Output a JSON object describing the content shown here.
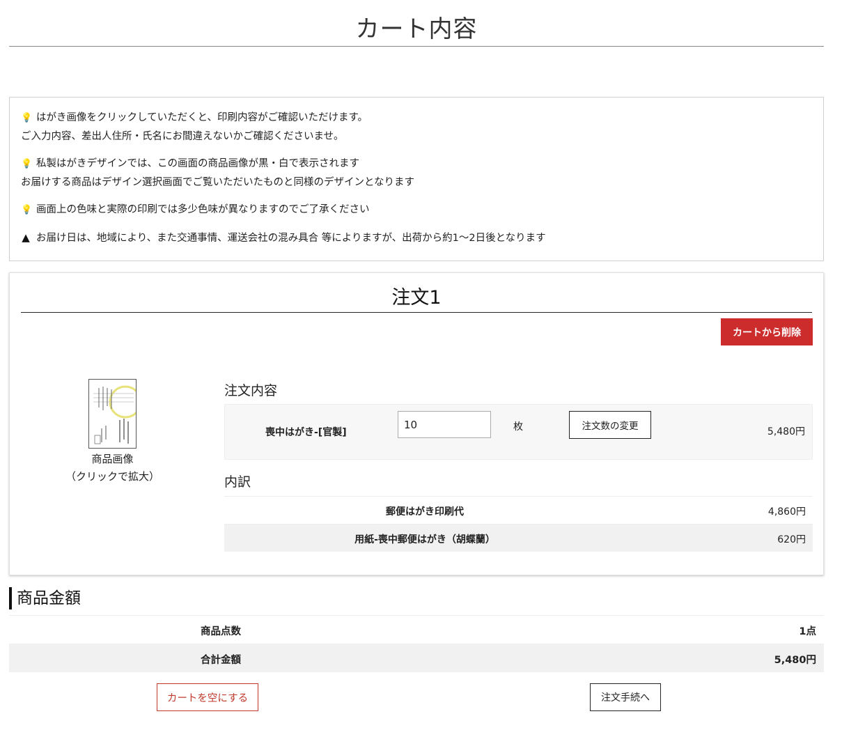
{
  "page": {
    "title": "カート内容"
  },
  "notices": [
    {
      "icon": "lightbulb-icon",
      "lines": [
        "はがき画像をクリックしていただくと、印刷内容がご確認いただけます。",
        "ご入力内容、差出人住所・氏名にお間違えないかご確認くださいませ。"
      ]
    },
    {
      "icon": "lightbulb-icon",
      "lines": [
        "私製はがきデザインでは、この画面の商品画像が黒・白で表示されます",
        "お届けする商品はデザイン選択画面でご覧いただいたものと同様のデザインとなります"
      ]
    },
    {
      "icon": "lightbulb-icon",
      "lines": [
        "画面上の色味と実際の印刷では多少色味が異なりますのでご了承ください"
      ]
    },
    {
      "icon": "warning-icon",
      "lines": [
        "お届け日は、地域により、また交通事情、運送会社の混み具合 等によりますが、出荷から約1～2日後となります"
      ]
    }
  ],
  "order": {
    "title": "注文1",
    "remove_label": "カートから削除",
    "image_caption_1": "商品画像",
    "image_caption_2": "（クリックで拡大）",
    "contents_heading": "注文内容",
    "product_name": "喪中はがき-[官製]",
    "quantity": "10",
    "quantity_unit": "枚",
    "change_label": "注文数の変更",
    "price": "5,480円",
    "breakdown_heading": "内訳",
    "breakdown": [
      {
        "label": "郵便はがき印刷代",
        "value": "4,860円"
      },
      {
        "label": "用紙-喪中郵便はがき（胡蝶蘭）",
        "value": "620円"
      }
    ]
  },
  "summary": {
    "heading": "商品金額",
    "rows": [
      {
        "label": "商品点数",
        "value": "1点"
      },
      {
        "label": "合計金額",
        "value": "5,480円"
      }
    ]
  },
  "actions": {
    "empty_cart": "カートを空にする",
    "checkout": "注文手続へ"
  },
  "colors": {
    "accent_red": "#cc2c2c"
  }
}
